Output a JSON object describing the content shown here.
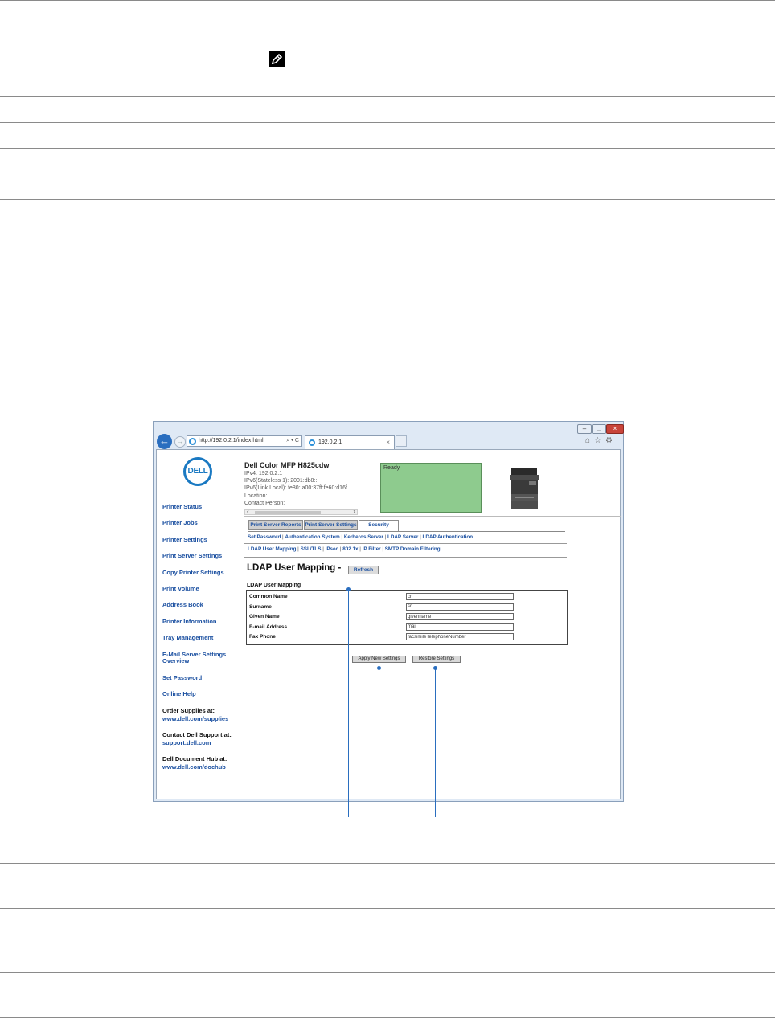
{
  "browser": {
    "address": "http://192.0.2.1/index.html",
    "address_tools": "⌕ ▾ C",
    "tab_title": "192.0.2.1",
    "tab_close": "×"
  },
  "logo": {
    "text": "DELL"
  },
  "sidebar": {
    "links": [
      "Printer Status",
      "Printer Jobs",
      "Printer Settings",
      "Print Server Settings",
      "Copy Printer Settings",
      "Print Volume",
      "Address Book",
      "Printer Information",
      "Tray Management",
      "E-Mail Server Settings",
      "Overview",
      "Set Password",
      "Online Help"
    ],
    "order_supplies": {
      "label": "Order Supplies at:",
      "link": "www.dell.com/supplies"
    },
    "contact_support": {
      "label": "Contact Dell Support at:",
      "link": "support.dell.com"
    },
    "document_hub": {
      "label": "Dell Document Hub at:",
      "link": "www.dell.com/dochub"
    }
  },
  "device": {
    "name": "Dell Color MFP H825cdw",
    "ipv4": "IPv4: 192.0.2.1",
    "ipv6_stateless": "IPv6(Stateless 1): 2001:db8::",
    "ipv6_link_local": "IPv6(Link Local): fe80::a00:37ff:fe60:d16f",
    "location": "Location:",
    "contact": "Contact Person:",
    "status": "Ready"
  },
  "tabs": [
    "Print Server Reports",
    "Print Server Settings",
    "Security"
  ],
  "subnav_row1": [
    "Set Password",
    "Authentication System",
    "Kerberos Server",
    "LDAP Server",
    "LDAP Authentication"
  ],
  "subnav_row2": [
    "LDAP User Mapping",
    "SSL/TLS",
    "IPsec",
    "802.1x",
    "IP Filter",
    "SMTP Domain Filtering"
  ],
  "separator": " | ",
  "page": {
    "title": "LDAP User Mapping -",
    "refresh": "Refresh",
    "section": "LDAP User Mapping",
    "fields": [
      {
        "label": "Common Name",
        "value": "cn"
      },
      {
        "label": "Surname",
        "value": "sn"
      },
      {
        "label": "Given Name",
        "value": "givenname"
      },
      {
        "label": "E-mail Address",
        "value": "mail"
      },
      {
        "label": "Fax Phone",
        "value": "facsimileTelephoneNumber"
      }
    ],
    "apply": "Apply New Settings",
    "restore": "Restore Settings"
  },
  "colors": {
    "accent": "#1a4fa0",
    "status_bg": "#8ecb8e",
    "callout": "#2a6ebf"
  }
}
